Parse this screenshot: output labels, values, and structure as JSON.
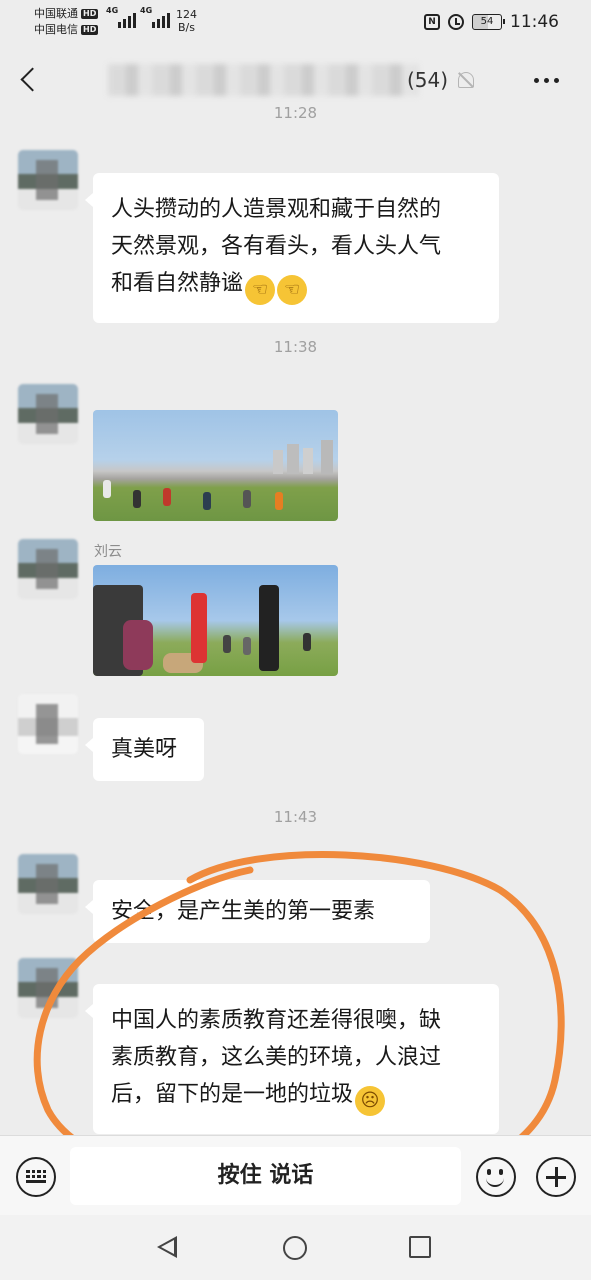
{
  "status_bar": {
    "carrier1": "中国联通",
    "carrier2": "中国电信",
    "hd": "HD",
    "network1": "4G",
    "network2": "4G",
    "speed_value": "124",
    "speed_unit": "B/s",
    "nfc": "N",
    "battery": "54",
    "time": "11:46"
  },
  "header": {
    "member_count": "(54)",
    "icons": [
      "back-arrow-icon",
      "mute-bell-icon",
      "more-icon"
    ]
  },
  "timestamps": [
    "11:28",
    "11:38",
    "11:43"
  ],
  "messages": [
    {
      "sender": "",
      "type": "text",
      "text_lines": [
        "人头攒动的人造景观和藏于自然的",
        "天然景观，各有看头，看人头人气",
        "和看自然静谧"
      ],
      "emoji": "hand-pointing-emoji"
    },
    {
      "sender": "",
      "type": "image"
    },
    {
      "sender": "刘云",
      "type": "image"
    },
    {
      "sender": "",
      "type": "text",
      "text_lines": [
        "真美呀"
      ]
    },
    {
      "sender": "",
      "type": "text",
      "text_lines": [
        "安全，是产生美的第一要素"
      ]
    },
    {
      "sender": "",
      "type": "text",
      "text_lines": [
        "中国人的素质教育还差得很噢，缺",
        "素质教育，这么美的环境，人浪过",
        "后，留下的是一地的垃圾"
      ],
      "emoji": "frowning-emoji"
    }
  ],
  "input_bar": {
    "hold_to_talk": "按住 说话"
  },
  "colors": {
    "background": "#ededed",
    "bubble": "#ffffff",
    "annotation": "#f08a3c"
  }
}
